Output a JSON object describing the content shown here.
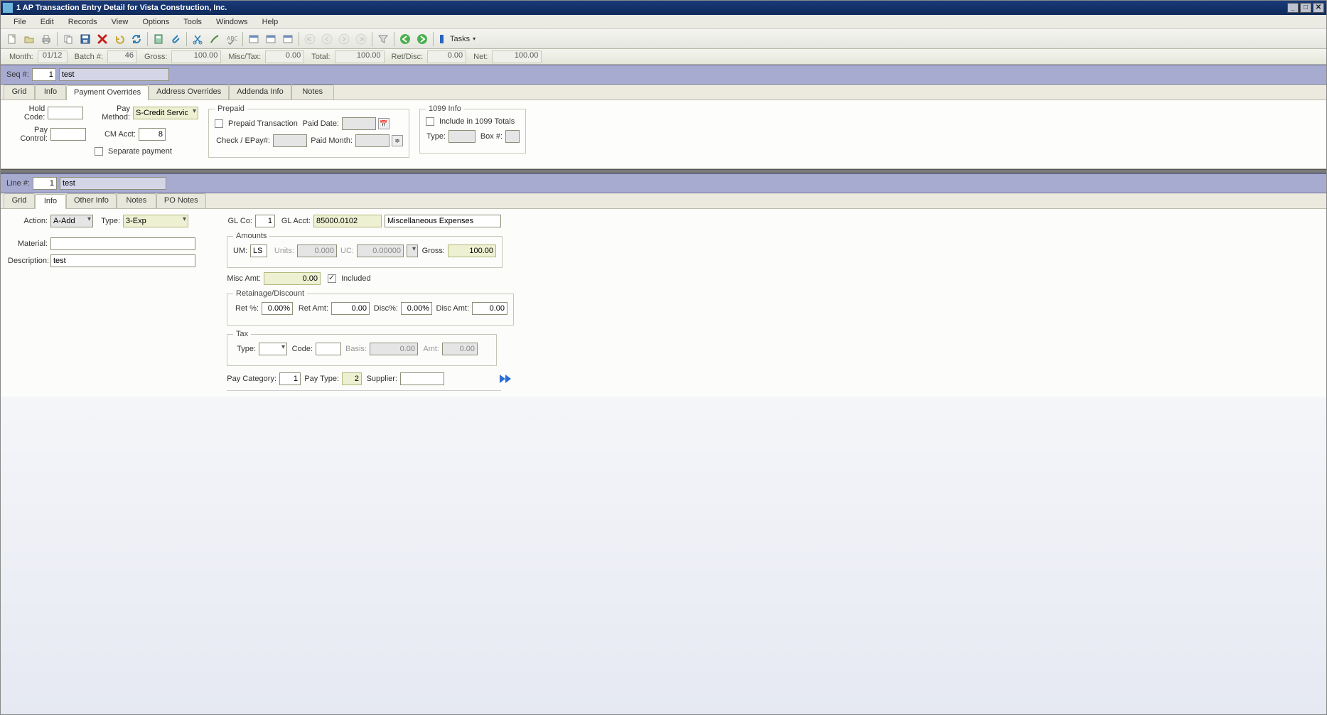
{
  "window": {
    "title": "1 AP Transaction Entry Detail for Vista Construction, Inc."
  },
  "menu": {
    "file": "File",
    "edit": "Edit",
    "records": "Records",
    "view": "View",
    "options": "Options",
    "tools": "Tools",
    "windows": "Windows",
    "help": "Help"
  },
  "toolbar": {
    "tasks": "Tasks"
  },
  "header": {
    "month_lbl": "Month:",
    "month": "01/12",
    "batch_lbl": "Batch #:",
    "batch": "46",
    "gross_lbl": "Gross:",
    "gross": "100.00",
    "misctax_lbl": "Misc/Tax:",
    "misctax": "0.00",
    "total_lbl": "Total:",
    "total": "100.00",
    "retdisc_lbl": "Ret/Disc:",
    "retdisc": "0.00",
    "net_lbl": "Net:",
    "net": "100.00"
  },
  "seq": {
    "lbl": "Seq #:",
    "num": "1",
    "desc": "test"
  },
  "tabs_top": {
    "grid": "Grid",
    "info": "Info",
    "payment_overrides": "Payment Overrides",
    "address_overrides": "Address Overrides",
    "addenda": "Addenda Info",
    "notes": "Notes"
  },
  "pay_ov": {
    "hold_code_lbl": "Hold Code:",
    "pay_method_lbl": "Pay Method:",
    "pay_method": "S-Credit Service",
    "pay_control_lbl": "Pay Control:",
    "cm_acct_lbl": "CM Acct:",
    "cm_acct": "8",
    "separate_payment_lbl": "Separate payment",
    "prepaid_legend": "Prepaid",
    "prepaid_trans_lbl": "Prepaid Transaction",
    "paid_date_lbl": "Paid Date:",
    "check_epay_lbl": "Check / EPay#:",
    "paid_month_lbl": "Paid Month:",
    "info1099_legend": "1099 Info",
    "include_1099_lbl": "Include in 1099 Totals",
    "type_lbl": "Type:",
    "box_lbl": "Box #:"
  },
  "line": {
    "lbl": "Line #:",
    "num": "1",
    "desc": "test"
  },
  "tabs_bottom": {
    "grid": "Grid",
    "info": "Info",
    "other": "Other Info",
    "notes": "Notes",
    "po_notes": "PO Notes"
  },
  "detail": {
    "action_lbl": "Action:",
    "action": "A-Add",
    "type_lbl": "Type:",
    "type": "3-Exp",
    "material_lbl": "Material:",
    "description_lbl": "Description:",
    "description": "test",
    "glco_lbl": "GL Co:",
    "glco": "1",
    "glacct_lbl": "GL Acct:",
    "glacct": "85000.0102",
    "glacct_desc": "Miscellaneous Expenses",
    "amounts_legend": "Amounts",
    "um_lbl": "UM:",
    "um": "LS",
    "units_lbl": "Units:",
    "units": "0.000",
    "uc_lbl": "UC:",
    "uc": "0.00000",
    "gross_lbl": "Gross:",
    "gross": "100.00",
    "misc_amt_lbl": "Misc Amt:",
    "misc_amt": "0.00",
    "included_lbl": "Included",
    "retdisc_legend": "Retainage/Discount",
    "retpct_lbl": "Ret %:",
    "retpct": "0.00%",
    "retamt_lbl": "Ret Amt:",
    "retamt": "0.00",
    "discpct_lbl": "Disc%:",
    "discpct": "0.00%",
    "discamt_lbl": "Disc Amt:",
    "discamt": "0.00",
    "tax_legend": "Tax",
    "tax_type_lbl": "Type:",
    "tax_code_lbl": "Code:",
    "tax_basis_lbl": "Basis:",
    "tax_basis": "0.00",
    "tax_amt_lbl": "Amt:",
    "tax_amt": "0.00",
    "paycat_lbl": "Pay Category:",
    "paycat": "1",
    "paytype_lbl": "Pay Type:",
    "paytype": "2",
    "supplier_lbl": "Supplier:"
  }
}
